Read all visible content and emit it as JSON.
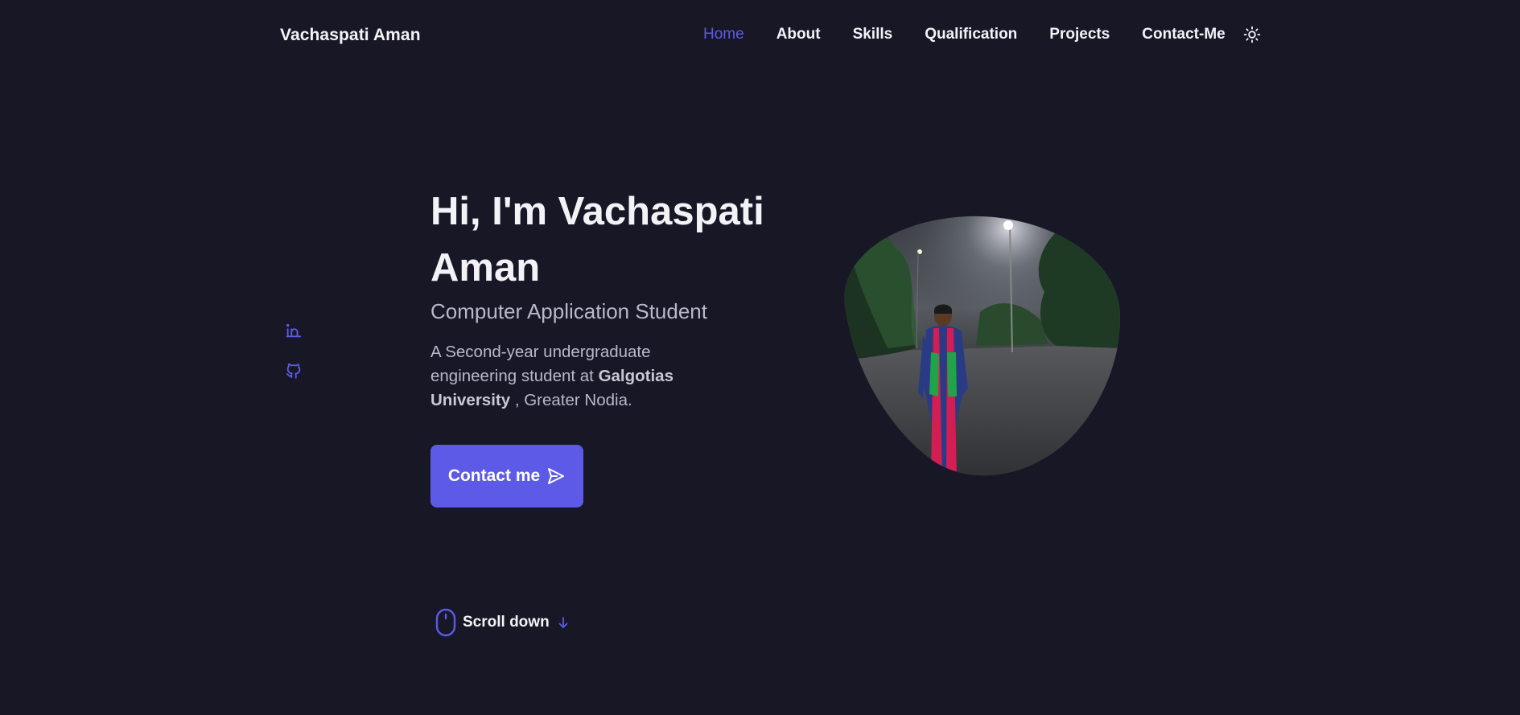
{
  "header": {
    "brand": "Vachaspati Aman",
    "nav": [
      {
        "label": "Home",
        "active": true
      },
      {
        "label": "About",
        "active": false
      },
      {
        "label": "Skills",
        "active": false
      },
      {
        "label": "Qualification",
        "active": false
      },
      {
        "label": "Projects",
        "active": false
      },
      {
        "label": "Contact-Me",
        "active": false
      }
    ],
    "theme_icon": "sun-icon"
  },
  "social": [
    {
      "icon": "linkedin-icon"
    },
    {
      "icon": "github-icon"
    }
  ],
  "hero": {
    "title": "Hi, I'm Vachaspati Aman",
    "subtitle": "Computer Application Student",
    "desc_prefix": "A Second-year undergraduate engineering student at ",
    "desc_bold": "Galgotias University",
    "desc_suffix": " , Greater Nodia.",
    "button_label": "Contact me",
    "button_icon": "send-icon",
    "photo_icon": "profile-photo"
  },
  "scroll": {
    "label": "Scroll down",
    "mouse_icon": "mouse-icon",
    "arrow_icon": "arrow-down-icon"
  },
  "colors": {
    "background": "#181726",
    "accent": "#5d5ae8",
    "text": "#f3f3f7",
    "muted": "#b9b8c9"
  }
}
